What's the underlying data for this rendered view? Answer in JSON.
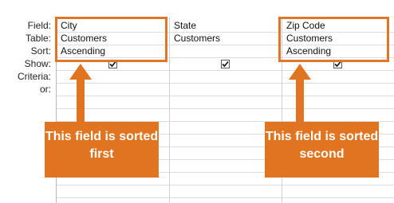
{
  "row_labels": [
    "Field:",
    "Table:",
    "Sort:",
    "Show:",
    "Criteria:",
    "or:"
  ],
  "columns": [
    {
      "field": "City",
      "table": "Customers",
      "sort": "Ascending",
      "show": true
    },
    {
      "field": "State",
      "table": "Customers",
      "sort": "",
      "show": true
    },
    {
      "field": "Zip Code",
      "table": "Customers",
      "sort": "Ascending",
      "show": true
    }
  ],
  "callouts": {
    "first": "This field is sorted first",
    "second": "This field is sorted second"
  },
  "colors": {
    "accent": "#e07420"
  }
}
